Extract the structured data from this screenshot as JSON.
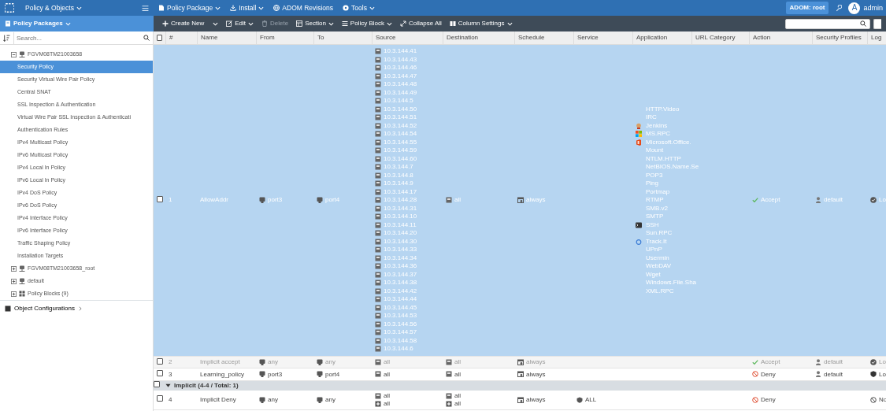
{
  "app_menu": {
    "title": "Policy & Objects"
  },
  "top_menu": [
    {
      "label": "Policy Package",
      "kind": "doc",
      "dropdown": true
    },
    {
      "label": "Install",
      "kind": "download",
      "dropdown": true
    },
    {
      "label": "ADOM Revisions",
      "kind": "globe",
      "dropdown": false
    },
    {
      "label": "Tools",
      "kind": "gear",
      "dropdown": true
    }
  ],
  "adom": "ADOM: root",
  "user": {
    "initial": "A",
    "name": "admin"
  },
  "sidebar": {
    "header": "Policy Packages",
    "search_placeholder": "Search...",
    "tree": [
      {
        "label": "FGVM08TM21003658",
        "kind": "device",
        "expanded": true,
        "selected": false,
        "children": [
          {
            "label": "Security Policy",
            "selected": true
          },
          {
            "label": "Security Virtual Wire Pair Policy",
            "selected": false
          },
          {
            "label": "Central SNAT",
            "selected": false
          },
          {
            "label": "SSL Inspection & Authentication",
            "selected": false
          },
          {
            "label": "Virtual Wire Pair SSL Inspection & Authenticati",
            "selected": false
          },
          {
            "label": "Authentication Rules",
            "selected": false
          },
          {
            "label": "IPv4 Multicast Policy",
            "selected": false
          },
          {
            "label": "IPv6 Multicast Policy",
            "selected": false
          },
          {
            "label": "IPv4 Local In Policy",
            "selected": false
          },
          {
            "label": "IPv6 Local In Policy",
            "selected": false
          },
          {
            "label": "IPv4 DoS Policy",
            "selected": false
          },
          {
            "label": "IPv6 DoS Policy",
            "selected": false
          },
          {
            "label": "IPv4 Interface Policy",
            "selected": false
          },
          {
            "label": "IPv6 Interface Policy",
            "selected": false
          },
          {
            "label": "Traffic Shaping Policy",
            "selected": false
          },
          {
            "label": "Installation Targets",
            "selected": false
          }
        ]
      },
      {
        "label": "FGVM08TM21003658_root",
        "kind": "device",
        "expanded": false,
        "selected": false
      },
      {
        "label": "default",
        "kind": "device",
        "expanded": false,
        "selected": false
      },
      {
        "label": "Policy Blocks (9)",
        "kind": "blocks",
        "expanded": false,
        "selected": false
      }
    ],
    "footer": "Object Configurations"
  },
  "toolbar": [
    {
      "label": "Create New",
      "kind": "plus",
      "dropdown": true,
      "disabled": false
    },
    {
      "label": "Edit",
      "kind": "edit",
      "dropdown": true,
      "disabled": false
    },
    {
      "label": "Delete",
      "kind": "trash",
      "dropdown": false,
      "disabled": true
    },
    {
      "label": "Section",
      "kind": "section",
      "dropdown": true,
      "disabled": false
    },
    {
      "label": "Policy Block",
      "kind": "list",
      "dropdown": true,
      "disabled": false
    },
    {
      "label": "Collapse All",
      "kind": "collapse",
      "dropdown": false,
      "disabled": false
    },
    {
      "label": "Column Settings",
      "kind": "columns",
      "dropdown": true,
      "disabled": false
    }
  ],
  "table": {
    "header_checked": false,
    "columns": [
      "#",
      "Name",
      "From",
      "To",
      "Source",
      "Destination",
      "Schedule",
      "Service",
      "Application",
      "URL Category",
      "Action",
      "Security Profiles",
      "Log"
    ],
    "rows": [
      {
        "kind": "policy",
        "selected": true,
        "disabled": false,
        "checked": false,
        "number": "1",
        "name": "AllowAddr",
        "from": [
          "port3"
        ],
        "to": [
          "port4"
        ],
        "source": [
          "10.3.144.41",
          "10.3.144.43",
          "10.3.144.46",
          "10.3.144.47",
          "10.3.144.48",
          "10.3.144.49",
          "10.3.144.5",
          "10.3.144.50",
          "10.3.144.51",
          "10.3.144.52",
          "10.3.144.54",
          "10.3.144.55",
          "10.3.144.59",
          "10.3.144.60",
          "10.3.144.7",
          "10.3.144.8",
          "10.3.144.9",
          "10.3.144.17",
          "10.3.144.28",
          "10.3.144.31",
          "10.3.144.10",
          "10.3.144.11",
          "10.3.144.20",
          "10.3.144.30",
          "10.3.144.33",
          "10.3.144.34",
          "10.3.144.36",
          "10.3.144.37",
          "10.3.144.38",
          "10.3.144.42",
          "10.3.144.44",
          "10.3.144.45",
          "10.3.144.53",
          "10.3.144.56",
          "10.3.144.57",
          "10.3.144.58",
          "10.3.144.6"
        ],
        "destination": [
          "all"
        ],
        "schedule": [
          "always"
        ],
        "application": [
          {
            "text": "HTTP.Video",
            "kind": "plain"
          },
          {
            "text": "IRC",
            "kind": "plain"
          },
          {
            "text": "Jenkins",
            "kind": "butler"
          },
          {
            "text": "MS.RPC",
            "kind": "tiles"
          },
          {
            "text": "Microsoft.Office.",
            "kind": "office"
          },
          {
            "text": "Mount",
            "kind": "plain"
          },
          {
            "text": "NTLM.HTTP",
            "kind": "plain"
          },
          {
            "text": "NetBIOS.Name.Se",
            "kind": "plain"
          },
          {
            "text": "POP3",
            "kind": "plain"
          },
          {
            "text": "Ping",
            "kind": "plain"
          },
          {
            "text": "Portmap",
            "kind": "plain"
          },
          {
            "text": "RTMP",
            "kind": "plain"
          },
          {
            "text": "SMB.v2",
            "kind": "plain"
          },
          {
            "text": "SMTP",
            "kind": "plain"
          },
          {
            "text": "SSH",
            "kind": "terminal"
          },
          {
            "text": "Sun.RPC",
            "kind": "plain"
          },
          {
            "text": "Track.It",
            "kind": "ring"
          },
          {
            "text": "UPnP",
            "kind": "plain"
          },
          {
            "text": "Usermin",
            "kind": "plain"
          },
          {
            "text": "WebDAV",
            "kind": "plain"
          },
          {
            "text": "Wget",
            "kind": "plain"
          },
          {
            "text": "Windows.File.Sha",
            "kind": "plain"
          },
          {
            "text": "XML.RPC",
            "kind": "plain"
          }
        ],
        "action": {
          "label": "Accept",
          "kind": "accept"
        },
        "profiles": [
          "default"
        ],
        "log": {
          "label": "Lo",
          "kind": "all"
        }
      },
      {
        "kind": "policy",
        "selected": false,
        "disabled": true,
        "checked": false,
        "number": "2",
        "name": "Implicit accept",
        "from": [
          "any"
        ],
        "to": [
          "any"
        ],
        "source": [
          "all"
        ],
        "destination": [
          "all"
        ],
        "schedule": [
          "always"
        ],
        "action": {
          "label": "Accept",
          "kind": "accept"
        },
        "profiles": [
          "default"
        ],
        "log": {
          "label": "Lo",
          "kind": "all"
        }
      },
      {
        "kind": "policy",
        "selected": false,
        "disabled": false,
        "checked": false,
        "number": "3",
        "name": "Learning_policy",
        "from": [
          "port3"
        ],
        "to": [
          "port4"
        ],
        "source": [
          "all"
        ],
        "destination": [
          "all"
        ],
        "schedule": [
          "always"
        ],
        "action": {
          "label": "Deny",
          "kind": "deny"
        },
        "profiles": [
          "default"
        ],
        "log": {
          "label": "Lo",
          "kind": "security"
        }
      },
      {
        "kind": "group",
        "checked": false,
        "expanded": true,
        "label": "Implicit (4-4 / Total: 1)"
      },
      {
        "kind": "policy",
        "selected": false,
        "disabled": false,
        "checked": false,
        "number": "4",
        "name": "Implicit Deny",
        "from": [
          "any"
        ],
        "to": [
          "any"
        ],
        "source": [
          "all"
        ],
        "source_extra": [
          "all"
        ],
        "destination": [
          "all"
        ],
        "destination_extra": [
          "all"
        ],
        "schedule": [
          "always"
        ],
        "service": [
          "ALL"
        ],
        "action": {
          "label": "Deny",
          "kind": "deny"
        },
        "log": {
          "label": "No",
          "kind": "none"
        }
      }
    ]
  }
}
